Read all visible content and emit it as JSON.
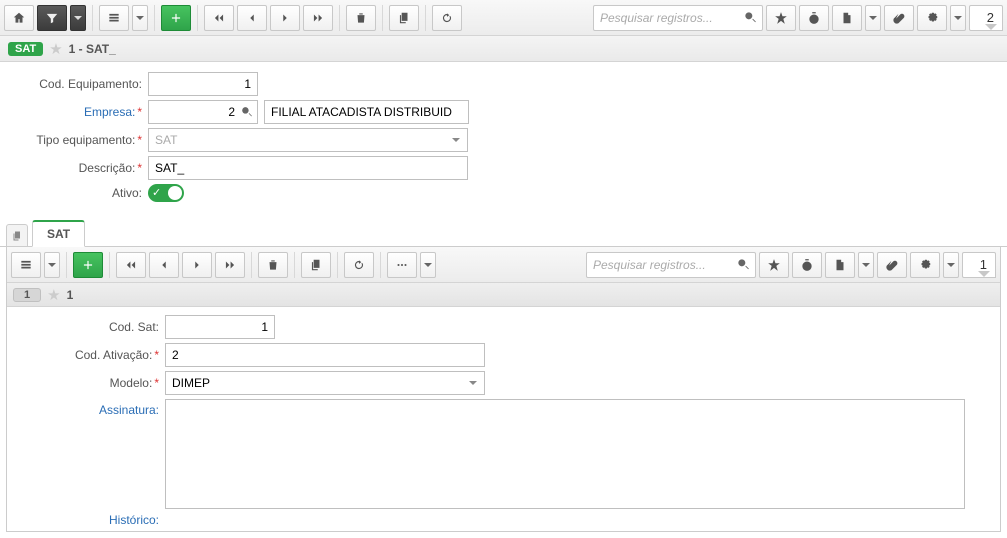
{
  "header": {
    "search_placeholder": "Pesquisar registros...",
    "count": "2"
  },
  "record": {
    "tag": "SAT",
    "title": "1 - SAT_"
  },
  "form": {
    "labels": {
      "cod_equipamento": "Cod. Equipamento:",
      "empresa": "Empresa:",
      "tipo_equipamento": "Tipo equipamento:",
      "descricao": "Descrição:",
      "ativo": "Ativo:"
    },
    "values": {
      "cod_equipamento": "1",
      "empresa": "2",
      "empresa_nome": "FILIAL ATACADISTA DISTRIBUID",
      "tipo_equipamento": "SAT",
      "descricao": "SAT_"
    }
  },
  "tab": {
    "label": "SAT"
  },
  "panel": {
    "search_placeholder": "Pesquisar registros...",
    "count": "1",
    "rec_badge": "1",
    "rec_title": "1",
    "labels": {
      "cod_sat": "Cod. Sat:",
      "cod_ativacao": "Cod. Ativação:",
      "modelo": "Modelo:",
      "assinatura": "Assinatura:",
      "historico": "Histórico:"
    },
    "values": {
      "cod_sat": "1",
      "cod_ativacao": "2",
      "modelo": "DIMEP"
    }
  }
}
